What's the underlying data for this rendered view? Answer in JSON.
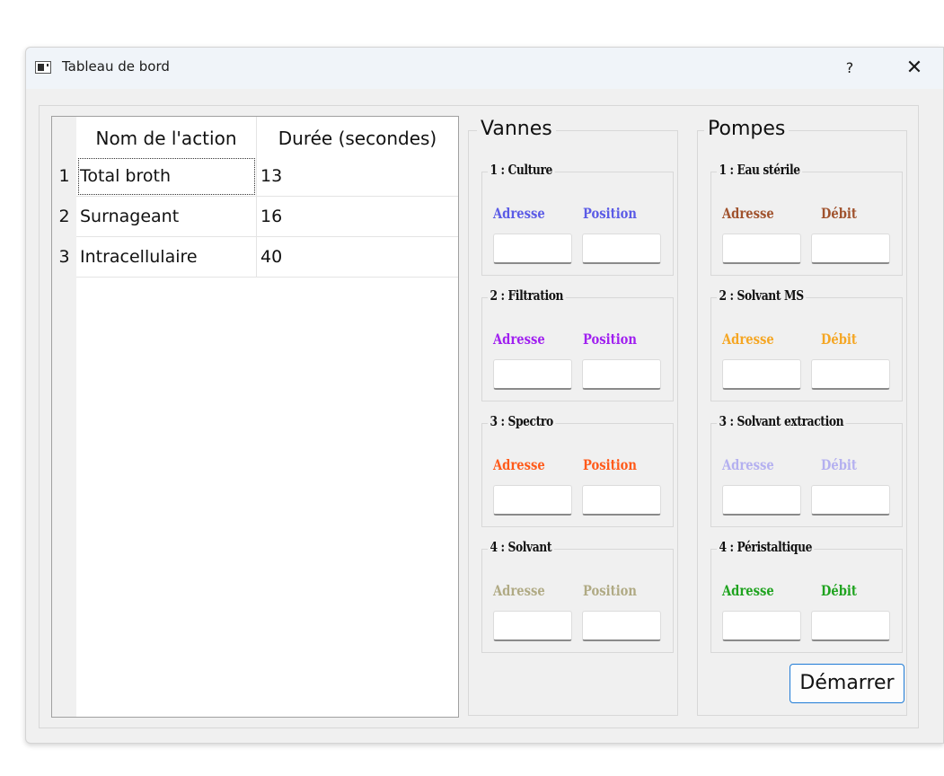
{
  "window": {
    "title": "Tableau de bord",
    "help_label": "?",
    "close_label": "✕"
  },
  "table": {
    "headers": [
      "Nom de l'action",
      "Durée (secondes)"
    ],
    "rows": [
      {
        "num": "1",
        "name": "Total broth",
        "duration": "13"
      },
      {
        "num": "2",
        "name": "Surnageant",
        "duration": "16"
      },
      {
        "num": "3",
        "name": "Intracellulaire",
        "duration": "40"
      }
    ]
  },
  "vannes": {
    "title": "Vannes",
    "groups": [
      {
        "title": "1 : Culture",
        "label_a": "Adresse",
        "label_b": "Position",
        "color": "#5b5be6",
        "value_a": "",
        "value_b": ""
      },
      {
        "title": "2 : Filtration",
        "label_a": "Adresse",
        "label_b": "Position",
        "color": "#a020f0",
        "value_a": "",
        "value_b": ""
      },
      {
        "title": "3 : Spectro",
        "label_a": "Adresse",
        "label_b": "Position",
        "color": "#ff5a1a",
        "value_a": "",
        "value_b": ""
      },
      {
        "title": "4 : Solvant",
        "label_a": "Adresse",
        "label_b": "Position",
        "color": "#b0aa84",
        "value_a": "",
        "value_b": ""
      }
    ]
  },
  "pompes": {
    "title": "Pompes",
    "groups": [
      {
        "title": "1 : Eau stérile",
        "label_a": "Adresse",
        "label_b": "Débit",
        "color": "#a0522d",
        "value_a": "",
        "value_b": ""
      },
      {
        "title": "2 : Solvant MS",
        "label_a": "Adresse",
        "label_b": "Débit",
        "color": "#f5a623",
        "value_a": "",
        "value_b": ""
      },
      {
        "title": "3 : Solvant extraction",
        "label_a": "Adresse",
        "label_b": "Débit",
        "color": "#b4b0f0",
        "value_a": "",
        "value_b": ""
      },
      {
        "title": "4 : Péristaltique",
        "label_a": "Adresse",
        "label_b": "Débit",
        "color": "#1fa31f",
        "value_a": "",
        "value_b": ""
      }
    ]
  },
  "start_button": {
    "label": "Démarrer"
  }
}
